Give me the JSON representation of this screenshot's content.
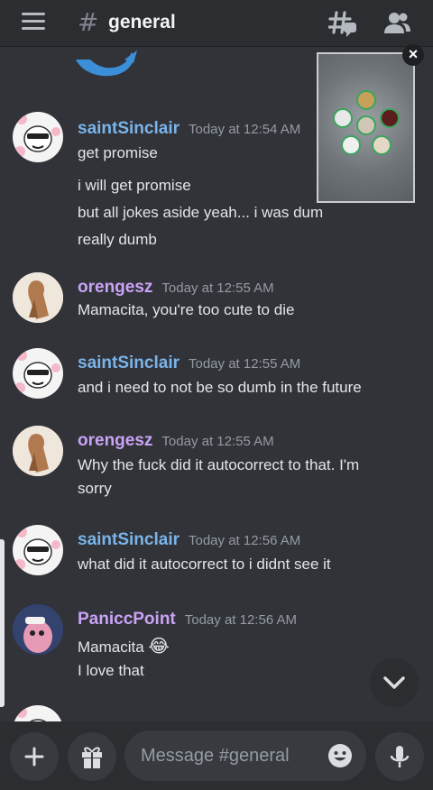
{
  "header": {
    "channel_name": "general",
    "hash": "#"
  },
  "pip_close": "×",
  "messages": [
    {
      "author": "saintSinclair",
      "time": "Today at 12:54 AM",
      "lines": [
        "get promise",
        "i will get promise",
        "but all jokes aside yeah... i was dum",
        "really dumb"
      ]
    },
    {
      "author": "orengesz",
      "time": "Today at 12:55 AM",
      "lines": [
        "Mamacita, you're too cute to die"
      ]
    },
    {
      "author": "saintSinclair",
      "time": "Today at 12:55 AM",
      "lines": [
        "and i need to not be so dumb in the future"
      ]
    },
    {
      "author": "orengesz",
      "time": "Today at 12:55 AM",
      "lines": [
        "Why the fuck did it autocorrect to that. I'm",
        "sorry"
      ]
    },
    {
      "author": "saintSinclair",
      "time": "Today at 12:56 AM",
      "lines": [
        "what did it autocorrect to i didnt see it"
      ]
    },
    {
      "author": "PaniccPoint",
      "time": "Today at 12:56 AM",
      "lines": [
        "Mamacita",
        "I love that"
      ],
      "emoji": "😂"
    }
  ],
  "composer": {
    "placeholder": "Message #general"
  },
  "colors": {
    "background": "#313338",
    "topbar": "#2b2d31",
    "blue_name": "#7ab4ea",
    "purple_name": "#c9a3f5",
    "speaking_ring": "#3ba55c"
  },
  "icons": [
    "hamburger-menu-icon",
    "channel-hash-icon",
    "threads-icon",
    "members-icon",
    "close-icon",
    "chevron-down-icon",
    "plus-icon",
    "gift-icon",
    "emoji-smile-icon",
    "microphone-icon"
  ]
}
